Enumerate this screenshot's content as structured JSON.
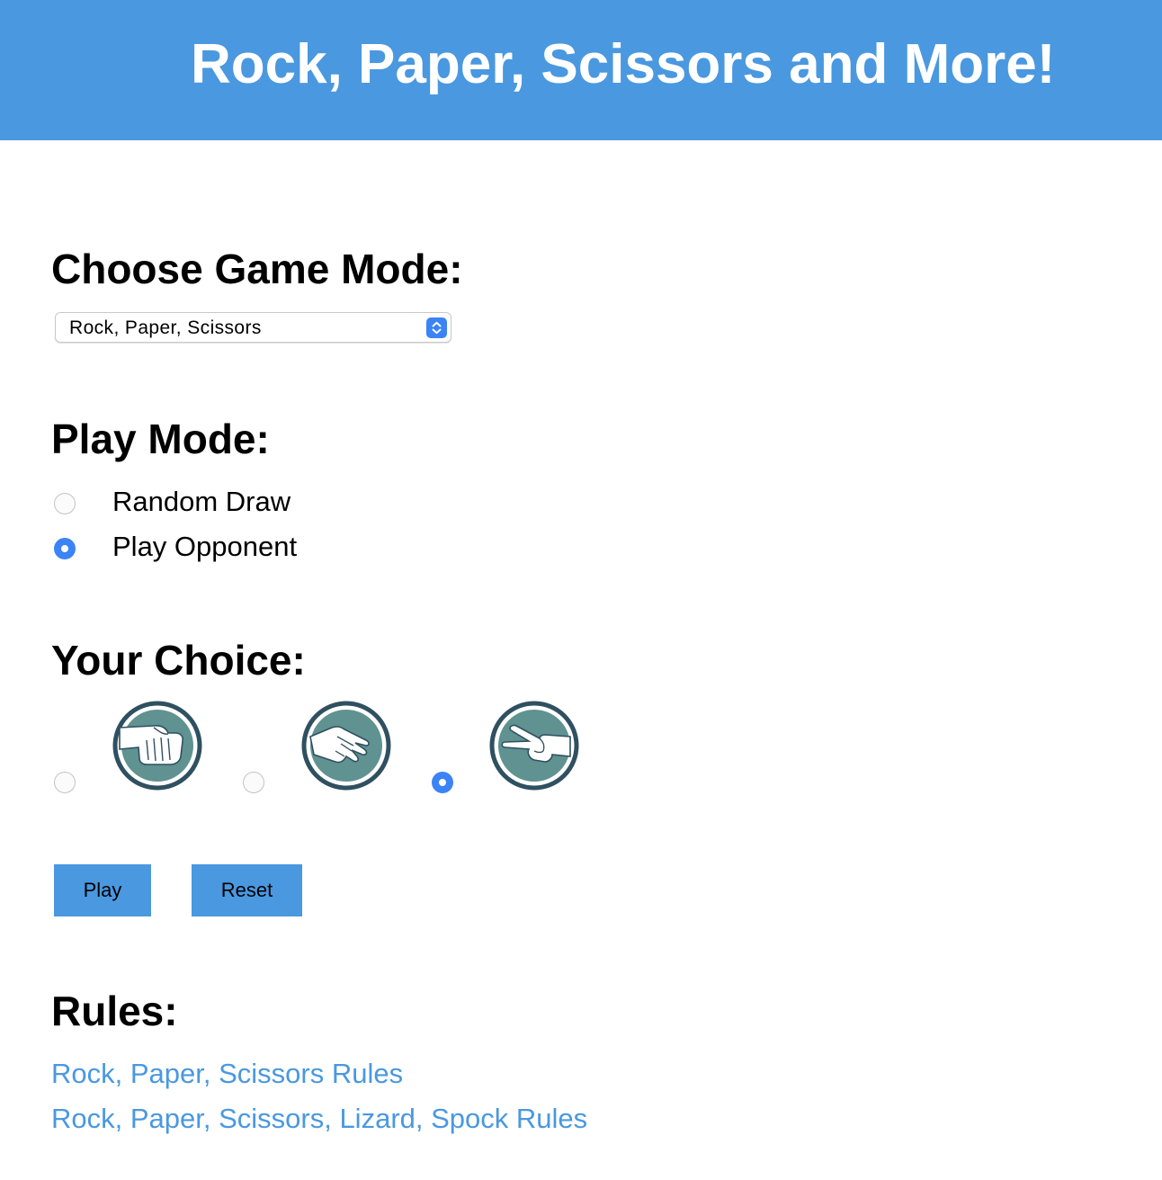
{
  "header": {
    "title": "Rock, Paper, Scissors and More!"
  },
  "game_mode": {
    "heading": "Choose Game Mode:",
    "selected": "Rock, Paper, Scissors"
  },
  "play_mode": {
    "heading": "Play Mode:",
    "options": [
      {
        "label": "Random Draw",
        "checked": false
      },
      {
        "label": "Play Opponent",
        "checked": true
      }
    ]
  },
  "your_choice": {
    "heading": "Your Choice:",
    "options": [
      {
        "icon": "rock-fist-icon",
        "checked": false
      },
      {
        "icon": "paper-hand-icon",
        "checked": false
      },
      {
        "icon": "scissors-hand-icon",
        "checked": true
      }
    ]
  },
  "buttons": {
    "play_label": "Play",
    "reset_label": "Reset"
  },
  "rules": {
    "heading": "Rules:",
    "links": [
      {
        "label": "Rock, Paper, Scissors Rules"
      },
      {
        "label": "Rock, Paper, Scissors, Lizard, Spock Rules"
      }
    ]
  },
  "colors": {
    "accent": "#4a98e0",
    "radio_checked": "#3b83f6",
    "icon_fill": "#5f9291",
    "icon_ring": "#2f5060"
  }
}
